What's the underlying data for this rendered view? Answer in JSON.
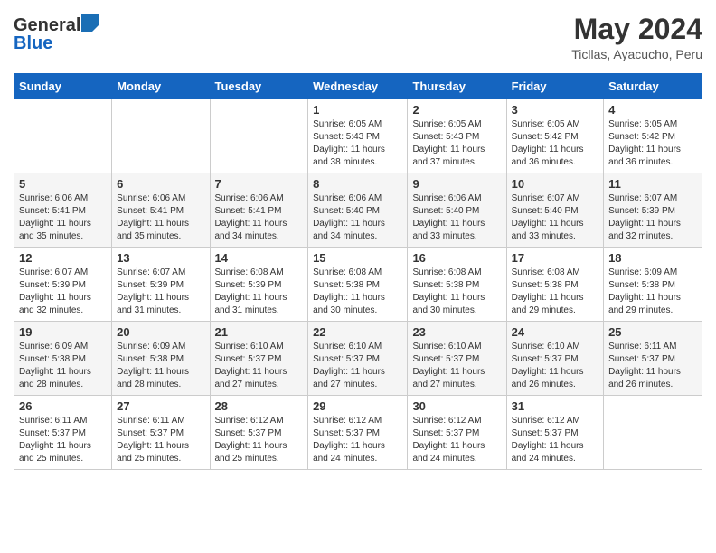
{
  "header": {
    "logo_general": "General",
    "logo_blue": "Blue",
    "month_title": "May 2024",
    "location": "Ticllas, Ayacucho, Peru"
  },
  "days_of_week": [
    "Sunday",
    "Monday",
    "Tuesday",
    "Wednesday",
    "Thursday",
    "Friday",
    "Saturday"
  ],
  "weeks": [
    [
      {
        "day": "",
        "info": ""
      },
      {
        "day": "",
        "info": ""
      },
      {
        "day": "",
        "info": ""
      },
      {
        "day": "1",
        "info": "Sunrise: 6:05 AM\nSunset: 5:43 PM\nDaylight: 11 hours\nand 38 minutes."
      },
      {
        "day": "2",
        "info": "Sunrise: 6:05 AM\nSunset: 5:43 PM\nDaylight: 11 hours\nand 37 minutes."
      },
      {
        "day": "3",
        "info": "Sunrise: 6:05 AM\nSunset: 5:42 PM\nDaylight: 11 hours\nand 36 minutes."
      },
      {
        "day": "4",
        "info": "Sunrise: 6:05 AM\nSunset: 5:42 PM\nDaylight: 11 hours\nand 36 minutes."
      }
    ],
    [
      {
        "day": "5",
        "info": "Sunrise: 6:06 AM\nSunset: 5:41 PM\nDaylight: 11 hours\nand 35 minutes."
      },
      {
        "day": "6",
        "info": "Sunrise: 6:06 AM\nSunset: 5:41 PM\nDaylight: 11 hours\nand 35 minutes."
      },
      {
        "day": "7",
        "info": "Sunrise: 6:06 AM\nSunset: 5:41 PM\nDaylight: 11 hours\nand 34 minutes."
      },
      {
        "day": "8",
        "info": "Sunrise: 6:06 AM\nSunset: 5:40 PM\nDaylight: 11 hours\nand 34 minutes."
      },
      {
        "day": "9",
        "info": "Sunrise: 6:06 AM\nSunset: 5:40 PM\nDaylight: 11 hours\nand 33 minutes."
      },
      {
        "day": "10",
        "info": "Sunrise: 6:07 AM\nSunset: 5:40 PM\nDaylight: 11 hours\nand 33 minutes."
      },
      {
        "day": "11",
        "info": "Sunrise: 6:07 AM\nSunset: 5:39 PM\nDaylight: 11 hours\nand 32 minutes."
      }
    ],
    [
      {
        "day": "12",
        "info": "Sunrise: 6:07 AM\nSunset: 5:39 PM\nDaylight: 11 hours\nand 32 minutes."
      },
      {
        "day": "13",
        "info": "Sunrise: 6:07 AM\nSunset: 5:39 PM\nDaylight: 11 hours\nand 31 minutes."
      },
      {
        "day": "14",
        "info": "Sunrise: 6:08 AM\nSunset: 5:39 PM\nDaylight: 11 hours\nand 31 minutes."
      },
      {
        "day": "15",
        "info": "Sunrise: 6:08 AM\nSunset: 5:38 PM\nDaylight: 11 hours\nand 30 minutes."
      },
      {
        "day": "16",
        "info": "Sunrise: 6:08 AM\nSunset: 5:38 PM\nDaylight: 11 hours\nand 30 minutes."
      },
      {
        "day": "17",
        "info": "Sunrise: 6:08 AM\nSunset: 5:38 PM\nDaylight: 11 hours\nand 29 minutes."
      },
      {
        "day": "18",
        "info": "Sunrise: 6:09 AM\nSunset: 5:38 PM\nDaylight: 11 hours\nand 29 minutes."
      }
    ],
    [
      {
        "day": "19",
        "info": "Sunrise: 6:09 AM\nSunset: 5:38 PM\nDaylight: 11 hours\nand 28 minutes."
      },
      {
        "day": "20",
        "info": "Sunrise: 6:09 AM\nSunset: 5:38 PM\nDaylight: 11 hours\nand 28 minutes."
      },
      {
        "day": "21",
        "info": "Sunrise: 6:10 AM\nSunset: 5:37 PM\nDaylight: 11 hours\nand 27 minutes."
      },
      {
        "day": "22",
        "info": "Sunrise: 6:10 AM\nSunset: 5:37 PM\nDaylight: 11 hours\nand 27 minutes."
      },
      {
        "day": "23",
        "info": "Sunrise: 6:10 AM\nSunset: 5:37 PM\nDaylight: 11 hours\nand 27 minutes."
      },
      {
        "day": "24",
        "info": "Sunrise: 6:10 AM\nSunset: 5:37 PM\nDaylight: 11 hours\nand 26 minutes."
      },
      {
        "day": "25",
        "info": "Sunrise: 6:11 AM\nSunset: 5:37 PM\nDaylight: 11 hours\nand 26 minutes."
      }
    ],
    [
      {
        "day": "26",
        "info": "Sunrise: 6:11 AM\nSunset: 5:37 PM\nDaylight: 11 hours\nand 25 minutes."
      },
      {
        "day": "27",
        "info": "Sunrise: 6:11 AM\nSunset: 5:37 PM\nDaylight: 11 hours\nand 25 minutes."
      },
      {
        "day": "28",
        "info": "Sunrise: 6:12 AM\nSunset: 5:37 PM\nDaylight: 11 hours\nand 25 minutes."
      },
      {
        "day": "29",
        "info": "Sunrise: 6:12 AM\nSunset: 5:37 PM\nDaylight: 11 hours\nand 24 minutes."
      },
      {
        "day": "30",
        "info": "Sunrise: 6:12 AM\nSunset: 5:37 PM\nDaylight: 11 hours\nand 24 minutes."
      },
      {
        "day": "31",
        "info": "Sunrise: 6:12 AM\nSunset: 5:37 PM\nDaylight: 11 hours\nand 24 minutes."
      },
      {
        "day": "",
        "info": ""
      }
    ]
  ]
}
